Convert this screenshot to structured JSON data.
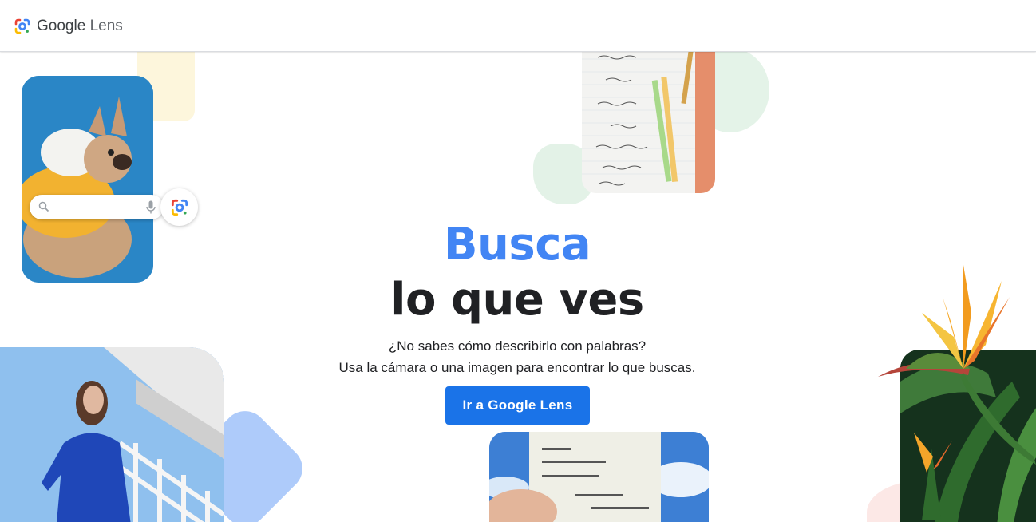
{
  "header": {
    "brand_google": "Google",
    "brand_lens": "Lens"
  },
  "hero": {
    "title_line1": "Busca",
    "title_line2": "lo que ves",
    "subtitle_line1": "¿No sabes cómo describirlo con palabras?",
    "subtitle_line2": "Usa la cámara o una imagen para encontrar lo que buscas.",
    "cta_label": "Ir a Google Lens"
  },
  "colors": {
    "accent_blue": "#4285f4",
    "button_blue": "#1a73e8",
    "text_dark": "#202124"
  },
  "icons": [
    "google-lens-logo-icon",
    "search-icon",
    "microphone-icon",
    "google-lens-icon"
  ]
}
